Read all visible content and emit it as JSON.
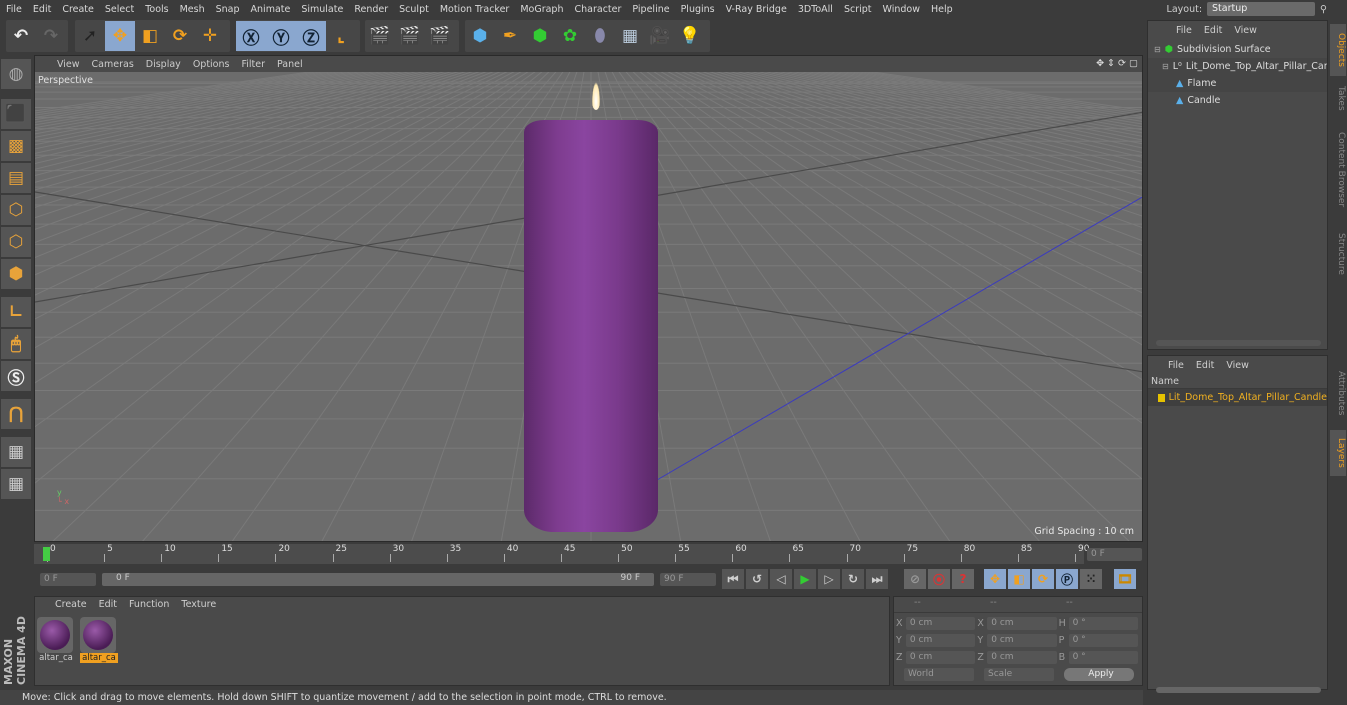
{
  "menu": [
    "File",
    "Edit",
    "Create",
    "Select",
    "Tools",
    "Mesh",
    "Snap",
    "Animate",
    "Simulate",
    "Render",
    "Sculpt",
    "Motion Tracker",
    "MoGraph",
    "Character",
    "Pipeline",
    "Plugins",
    "V-Ray Bridge",
    "3DToAll",
    "Script",
    "Window",
    "Help"
  ],
  "layout": {
    "label": "Layout:",
    "value": "Startup"
  },
  "viewport": {
    "menu": [
      "View",
      "Cameras",
      "Display",
      "Options",
      "Filter",
      "Panel"
    ],
    "camera": "Perspective",
    "grid_spacing": "Grid Spacing : 10 cm",
    "candle_color": "#7e3c8f"
  },
  "timeline": {
    "ticks": [
      "0",
      "5",
      "10",
      "15",
      "20",
      "25",
      "30",
      "35",
      "40",
      "45",
      "50",
      "55",
      "60",
      "65",
      "70",
      "75",
      "80",
      "85",
      "90"
    ],
    "current_frame": "0 F",
    "start": "0 F",
    "range_start": "0 F",
    "range_end": "90 F",
    "end": "90 F"
  },
  "materials": {
    "menu": [
      "Create",
      "Edit",
      "Function",
      "Texture"
    ],
    "items": [
      {
        "name": "altar_ca",
        "selected": false
      },
      {
        "name": "altar_ca",
        "selected": true
      }
    ]
  },
  "coords": {
    "headers": [
      "--",
      "--",
      "--"
    ],
    "rows": [
      [
        "X",
        "0 cm",
        "X",
        "0 cm",
        "H",
        "0 °"
      ],
      [
        "Y",
        "0 cm",
        "Y",
        "0 cm",
        "P",
        "0 °"
      ],
      [
        "Z",
        "0 cm",
        "Z",
        "0 cm",
        "B",
        "0 °"
      ]
    ],
    "mode": "World",
    "transform": "Scale",
    "apply": "Apply"
  },
  "objects": {
    "menu": [
      "File",
      "Edit",
      "View"
    ],
    "tree": [
      "Subdivision Surface",
      "Lit_Dome_Top_Altar_Pillar_Candl",
      "Flame",
      "Candle"
    ]
  },
  "layers": {
    "menu": [
      "File",
      "Edit",
      "View"
    ],
    "header": "Name",
    "item": "Lit_Dome_Top_Altar_Pillar_Candle",
    "item_color": "#e6c200"
  },
  "side_tabs": [
    "Objects",
    "Takes",
    "Content Browser",
    "Structure"
  ],
  "side_tabs2": [
    "Attributes",
    "Layers"
  ],
  "status": "Move: Click and drag to move elements. Hold down SHIFT to quantize movement / add to the selection in point mode, CTRL to remove.",
  "brand": "MAXON CINEMA 4D"
}
